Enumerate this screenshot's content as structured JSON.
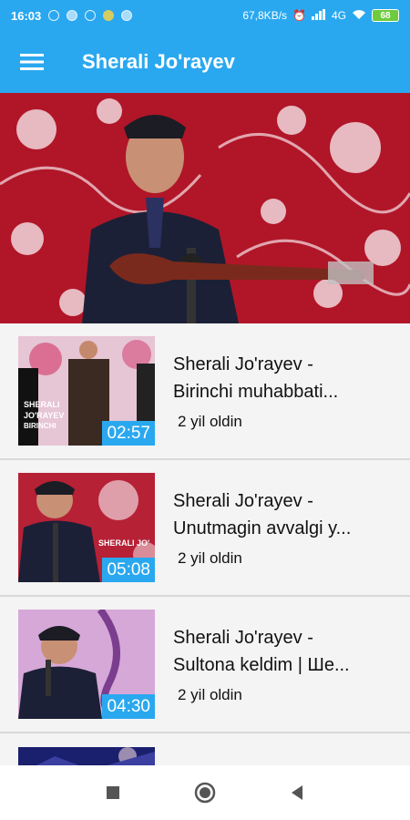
{
  "status_bar": {
    "time": "16:03",
    "network_speed": "67,8KB/s",
    "network_type": "4G",
    "battery": "68"
  },
  "app_bar": {
    "title": "Sherali Jo'rayev",
    "menu_icon": "hamburger-menu-icon"
  },
  "colors": {
    "primary": "#2aa8ef",
    "list_bg": "#f4f4f4",
    "divider": "#d9d9d9"
  },
  "videos": [
    {
      "title": "Sherali Jo'rayev -\nBirinchi muhabbati...",
      "age": "2 yil oldin",
      "duration": "02:57"
    },
    {
      "title": "Sherali Jo'rayev -\nUnutmagin avvalgi y...",
      "age": "2 yil oldin",
      "duration": "05:08"
    },
    {
      "title": "Sherali Jo'rayev -\nSultona keldim | Ше...",
      "age": "2 yil oldin",
      "duration": "04:30"
    }
  ],
  "nav_bar": {
    "recents_icon": "square-icon",
    "home_icon": "circle-icon",
    "back_icon": "triangle-back-icon"
  }
}
